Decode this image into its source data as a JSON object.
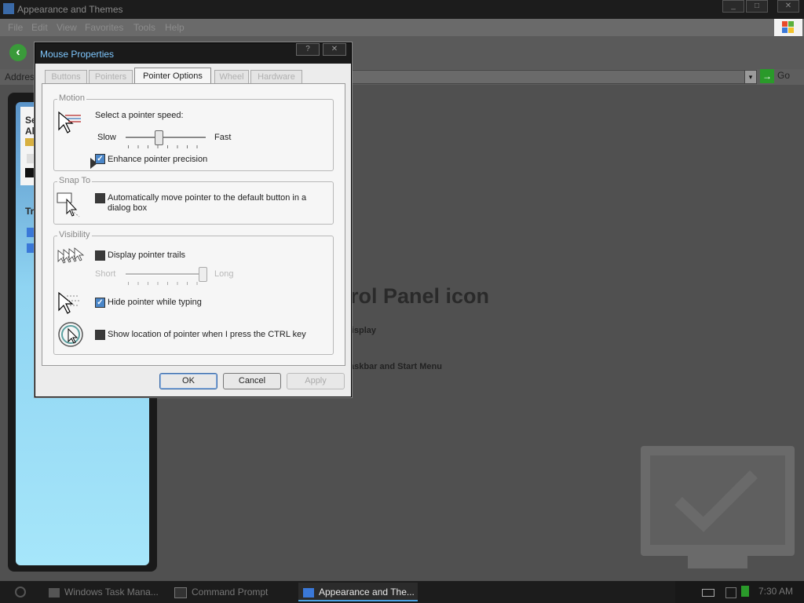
{
  "background_window": {
    "title": "Appearance and Themes",
    "menu": [
      "File",
      "Edit",
      "View",
      "Favorites",
      "Tools",
      "Help"
    ],
    "address_label": "Address",
    "go_label": "Go",
    "window_buttons": [
      "_",
      "□",
      "✕"
    ],
    "left_pane": {
      "section1": "See Also",
      "section2": "Troubleshooters"
    },
    "content": {
      "heading": "or pick a Control Panel icon",
      "links": [
        "Display",
        "Taskbar and Start Menu"
      ]
    }
  },
  "dialog": {
    "title": "Mouse Properties",
    "help_btn": "?",
    "close_btn": "✕",
    "tabs": [
      "Buttons",
      "Pointers",
      "Pointer Options",
      "Wheel",
      "Hardware"
    ],
    "active_tab": "Pointer Options",
    "motion": {
      "group_title": "Motion",
      "prompt": "Select a pointer speed:",
      "slow": "Slow",
      "fast": "Fast",
      "speed_level": 0.4,
      "enhance_label": "Enhance pointer precision",
      "enhance_checked": true
    },
    "snap_to": {
      "group_title": "Snap To",
      "label": "Automatically move pointer to the default button in a dialog box",
      "line1": "Automatically move pointer to the default button in a",
      "line2": "dialog box",
      "checked": false
    },
    "visibility": {
      "group_title": "Visibility",
      "trails_label": "Display pointer trails",
      "trails_checked": false,
      "trails_short": "Short",
      "trails_long": "Long",
      "trails_level": 1.0,
      "hide_label": "Hide pointer while typing",
      "hide_checked": true,
      "ctrl_label": "Show location of pointer when I press the CTRL key",
      "ctrl_checked": false
    },
    "buttons": {
      "ok": "OK",
      "cancel": "Cancel",
      "apply": "Apply"
    }
  },
  "taskbar": {
    "items": [
      "Windows Task Mana...",
      "Command Prompt",
      "Appearance and The..."
    ],
    "active_index": 2,
    "clock": "7:30 AM"
  },
  "colors": {
    "accent": "#4a86c8",
    "title_text": "#7fc8ff",
    "pane": "#8fd4f2"
  }
}
